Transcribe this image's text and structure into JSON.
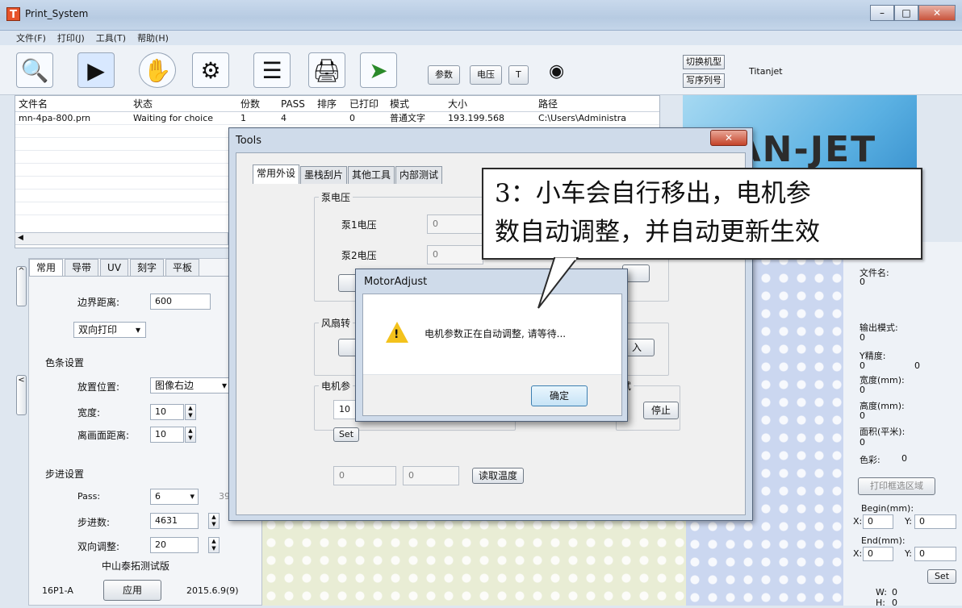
{
  "window": {
    "title": "Print_System",
    "app_icon": "T"
  },
  "menu": [
    "文件(F)",
    "打印(J)",
    "工具(T)",
    "帮助(H)"
  ],
  "toolbar": {
    "param_label": "参数",
    "voltage_label": "电压",
    "t_label": "T",
    "switch_model_label": "切换机型",
    "write_serial_label": "写序列号",
    "brand": "Titanjet"
  },
  "file_table": {
    "headers": [
      "文件名",
      "状态",
      "份数",
      "PASS",
      "排序",
      "已打印",
      "模式",
      "大小",
      "路径"
    ],
    "rows": [
      [
        "mn-4pa-800.prn",
        "Waiting for choice",
        "1",
        "4",
        "",
        "0",
        "普通文字",
        "193.199.568",
        "C:\\Users\\Administra"
      ]
    ]
  },
  "left_panel": {
    "tabs": [
      "常用",
      "导带",
      "UV",
      "刻字",
      "平板"
    ],
    "border_distance_label": "边界距离:",
    "border_distance_value": "600",
    "print_mode_value": "双向打印",
    "color_bar_title": "色条设置",
    "position_label": "放置位置:",
    "position_value": "图像右边",
    "width_label": "宽度:",
    "width_value": "10",
    "distance_label": "离画面距离:",
    "distance_value": "10",
    "step_title": "步进设置",
    "pass_label": "Pass:",
    "pass_value": "6",
    "pass_extra": "39",
    "step_label": "步进数:",
    "step_value": "4631",
    "bidir_label": "双向调整:",
    "bidir_value": "20",
    "version_label": "中山泰拓测试版",
    "model": "16P1-A",
    "apply_label": "应用",
    "date": "2015.6.9(9)"
  },
  "logo": {
    "text": "TÀN-JET"
  },
  "right_panel": {
    "filename_label": "文件名:",
    "filename_value": "0",
    "output_mode_label": "输出模式:",
    "output_mode_value": "0",
    "y_precision_label": "Y精度:",
    "y_precision_value_a": "0",
    "y_precision_value_b": "0",
    "width_label": "宽度(mm):",
    "width_value": "0",
    "height_label": "高度(mm):",
    "height_value": "0",
    "area_label": "面积(平米):",
    "area_value": "0",
    "color_label": "色彩:",
    "color_value": "0",
    "print_region_label": "打印框选区域",
    "begin_label": "Begin(mm):",
    "begin_x": "0",
    "begin_y": "0",
    "end_label": "End(mm):",
    "end_x": "0",
    "end_y": "0",
    "set_label": "Set",
    "w_label": "W:",
    "w_value": "0",
    "h_label": "H:",
    "h_value": "0",
    "x_label": "X:",
    "y_label": "Y:"
  },
  "tools_dialog": {
    "title": "Tools",
    "tabs": [
      "常用外设",
      "墨栈刮片",
      "其他工具",
      "内部测试"
    ],
    "pump_voltage_group": "泵电压",
    "pump1_label": "泵1电压",
    "pump1_value": "0",
    "pump2_label": "泵2电压",
    "pump2_value": "0",
    "fan_group": "风扇转",
    "motor_group": "电机参",
    "motor_value": "10",
    "set_label": "Set",
    "test_group": "试",
    "stop_label": "停止",
    "enter_label": "入",
    "temp_value_1": "0",
    "temp_value_2": "0",
    "read_temp_label": "读取温度"
  },
  "motor_dialog": {
    "title": "MotorAdjust",
    "message": "电机参数正在自动调整, 请等待...",
    "ok_label": "确定"
  },
  "callout": {
    "line1": "3：小车会自行移出，电机参",
    "line2": "数自动调整，并自动更新生效"
  },
  "colors": {
    "titlebar": "#c9d9ec",
    "dialog_frame": "#cfdbea",
    "close_button": "#c4442a",
    "logo_blue": "#5ab0e2",
    "warning_yellow": "#f3c21c"
  }
}
